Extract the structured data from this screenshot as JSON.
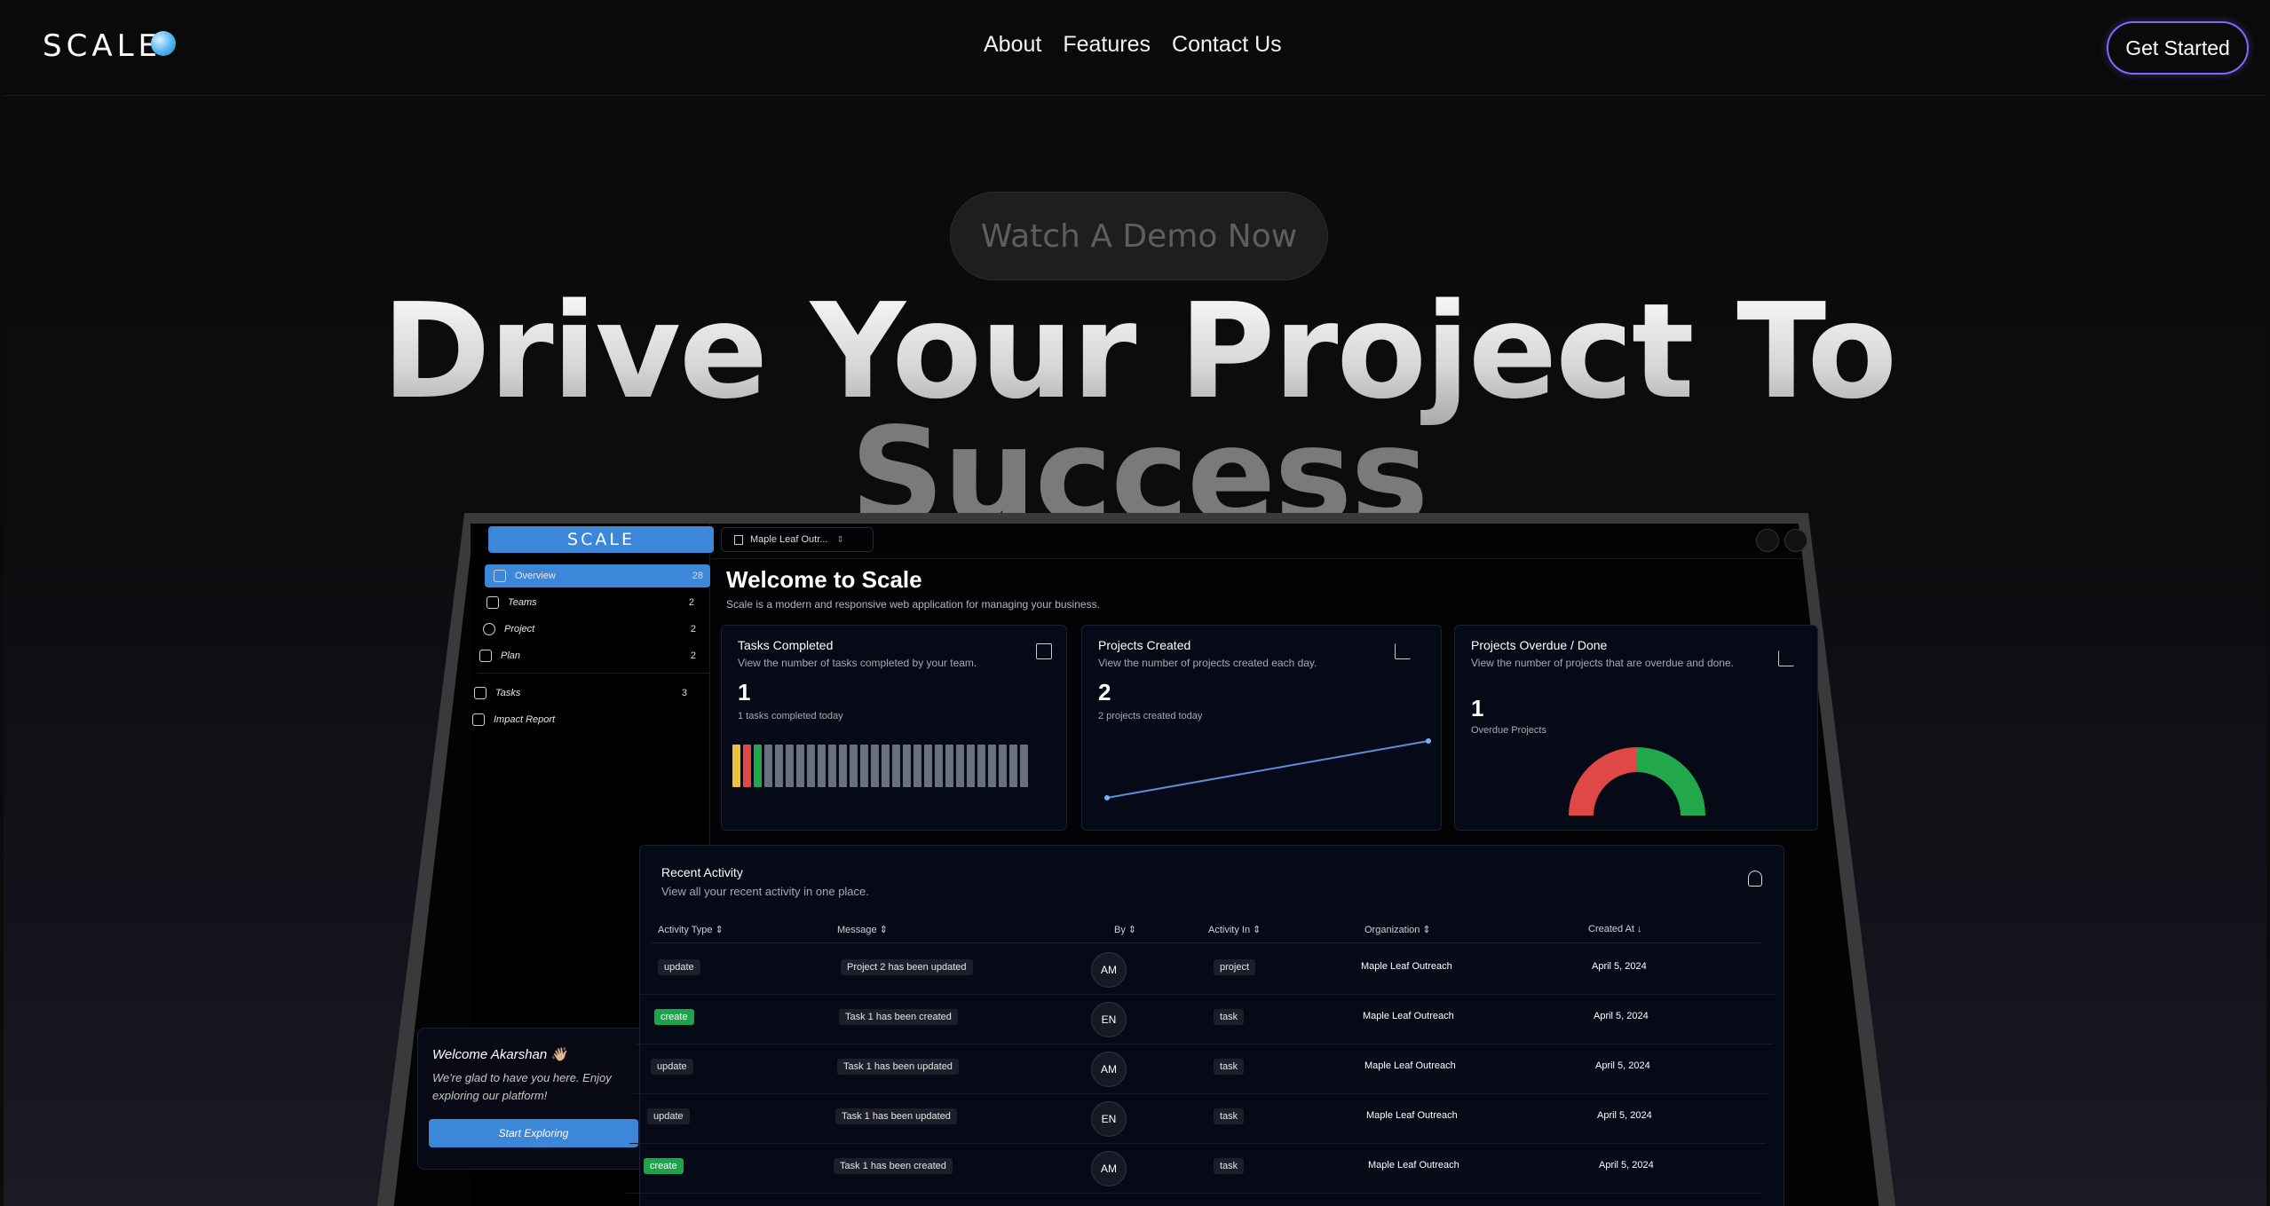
{
  "brand": {
    "logo_text": "SCALE"
  },
  "nav": {
    "links": [
      "About",
      "Features",
      "Contact Us"
    ],
    "cta_label": "Get Started"
  },
  "hero": {
    "demo_button": "Watch A Demo Now",
    "title_line1": "Drive Your Project To",
    "title_line2": "Success"
  },
  "app": {
    "logo_text": "SCALE",
    "org_select": "Maple Leaf Outr...",
    "sidebar": {
      "items": [
        {
          "label": "Overview",
          "count": "28",
          "icon": "overview-icon",
          "active": true
        },
        {
          "label": "Teams",
          "count": "2",
          "icon": "users-icon"
        },
        {
          "label": "Project",
          "count": "2",
          "icon": "target-icon"
        },
        {
          "label": "Plan",
          "count": "2",
          "icon": "send-icon"
        }
      ],
      "secondary": [
        {
          "label": "Tasks",
          "count": "3",
          "icon": "tasks-icon"
        },
        {
          "label": "Impact Report",
          "count": "",
          "icon": "bar-chart-icon"
        }
      ]
    },
    "welcome_card": {
      "title": "Welcome Akarshan 👋🏼",
      "text": "We're glad to have you here. Enjoy exploring our platform!",
      "button": "Start Exploring"
    },
    "main": {
      "title": "Welcome to Scale",
      "subtitle": "Scale is a modern and responsive web application for managing your business."
    },
    "cards": {
      "tasks": {
        "title": "Tasks Completed",
        "subtitle": "View the number of tasks completed by your team.",
        "value": "1",
        "note": "1 tasks completed today"
      },
      "projects": {
        "title": "Projects Created",
        "subtitle": "View the number of projects created each day.",
        "value": "2",
        "note": "2 projects created today"
      },
      "overdue": {
        "title": "Projects Overdue / Done",
        "subtitle": "View the number of projects that are overdue and done.",
        "value": "1",
        "note": "Overdue Projects"
      }
    },
    "activity": {
      "title": "Recent Activity",
      "subtitle": "View all your recent activity in one place.",
      "columns": [
        "Activity Type",
        "Message",
        "By",
        "Activity In",
        "Organization",
        "Created At"
      ],
      "rows": [
        {
          "type": "update",
          "message": "Project 2 has been updated",
          "by": "AM",
          "in": "project",
          "org": "Maple Leaf Outreach",
          "date": "April 5, 2024"
        },
        {
          "type": "create",
          "message": "Task 1 has been created",
          "by": "EN",
          "in": "task",
          "org": "Maple Leaf Outreach",
          "date": "April 5, 2024"
        },
        {
          "type": "update",
          "message": "Task 1 has been updated",
          "by": "AM",
          "in": "task",
          "org": "Maple Leaf Outreach",
          "date": "April 5, 2024"
        },
        {
          "type": "update",
          "message": "Task 1 has been updated",
          "by": "EN",
          "in": "task",
          "org": "Maple Leaf Outreach",
          "date": "April 5, 2024"
        },
        {
          "type": "create",
          "message": "Task 1 has been created",
          "by": "AM",
          "in": "task",
          "org": "Maple Leaf Outreach",
          "date": "April 5, 2024"
        }
      ]
    }
  },
  "colors": {
    "accent": "#3c87d8",
    "cta_border": "#7b6cff",
    "create_tag": "#1fa34a",
    "gauge_red": "#e04848",
    "gauge_green": "#22a84a"
  }
}
